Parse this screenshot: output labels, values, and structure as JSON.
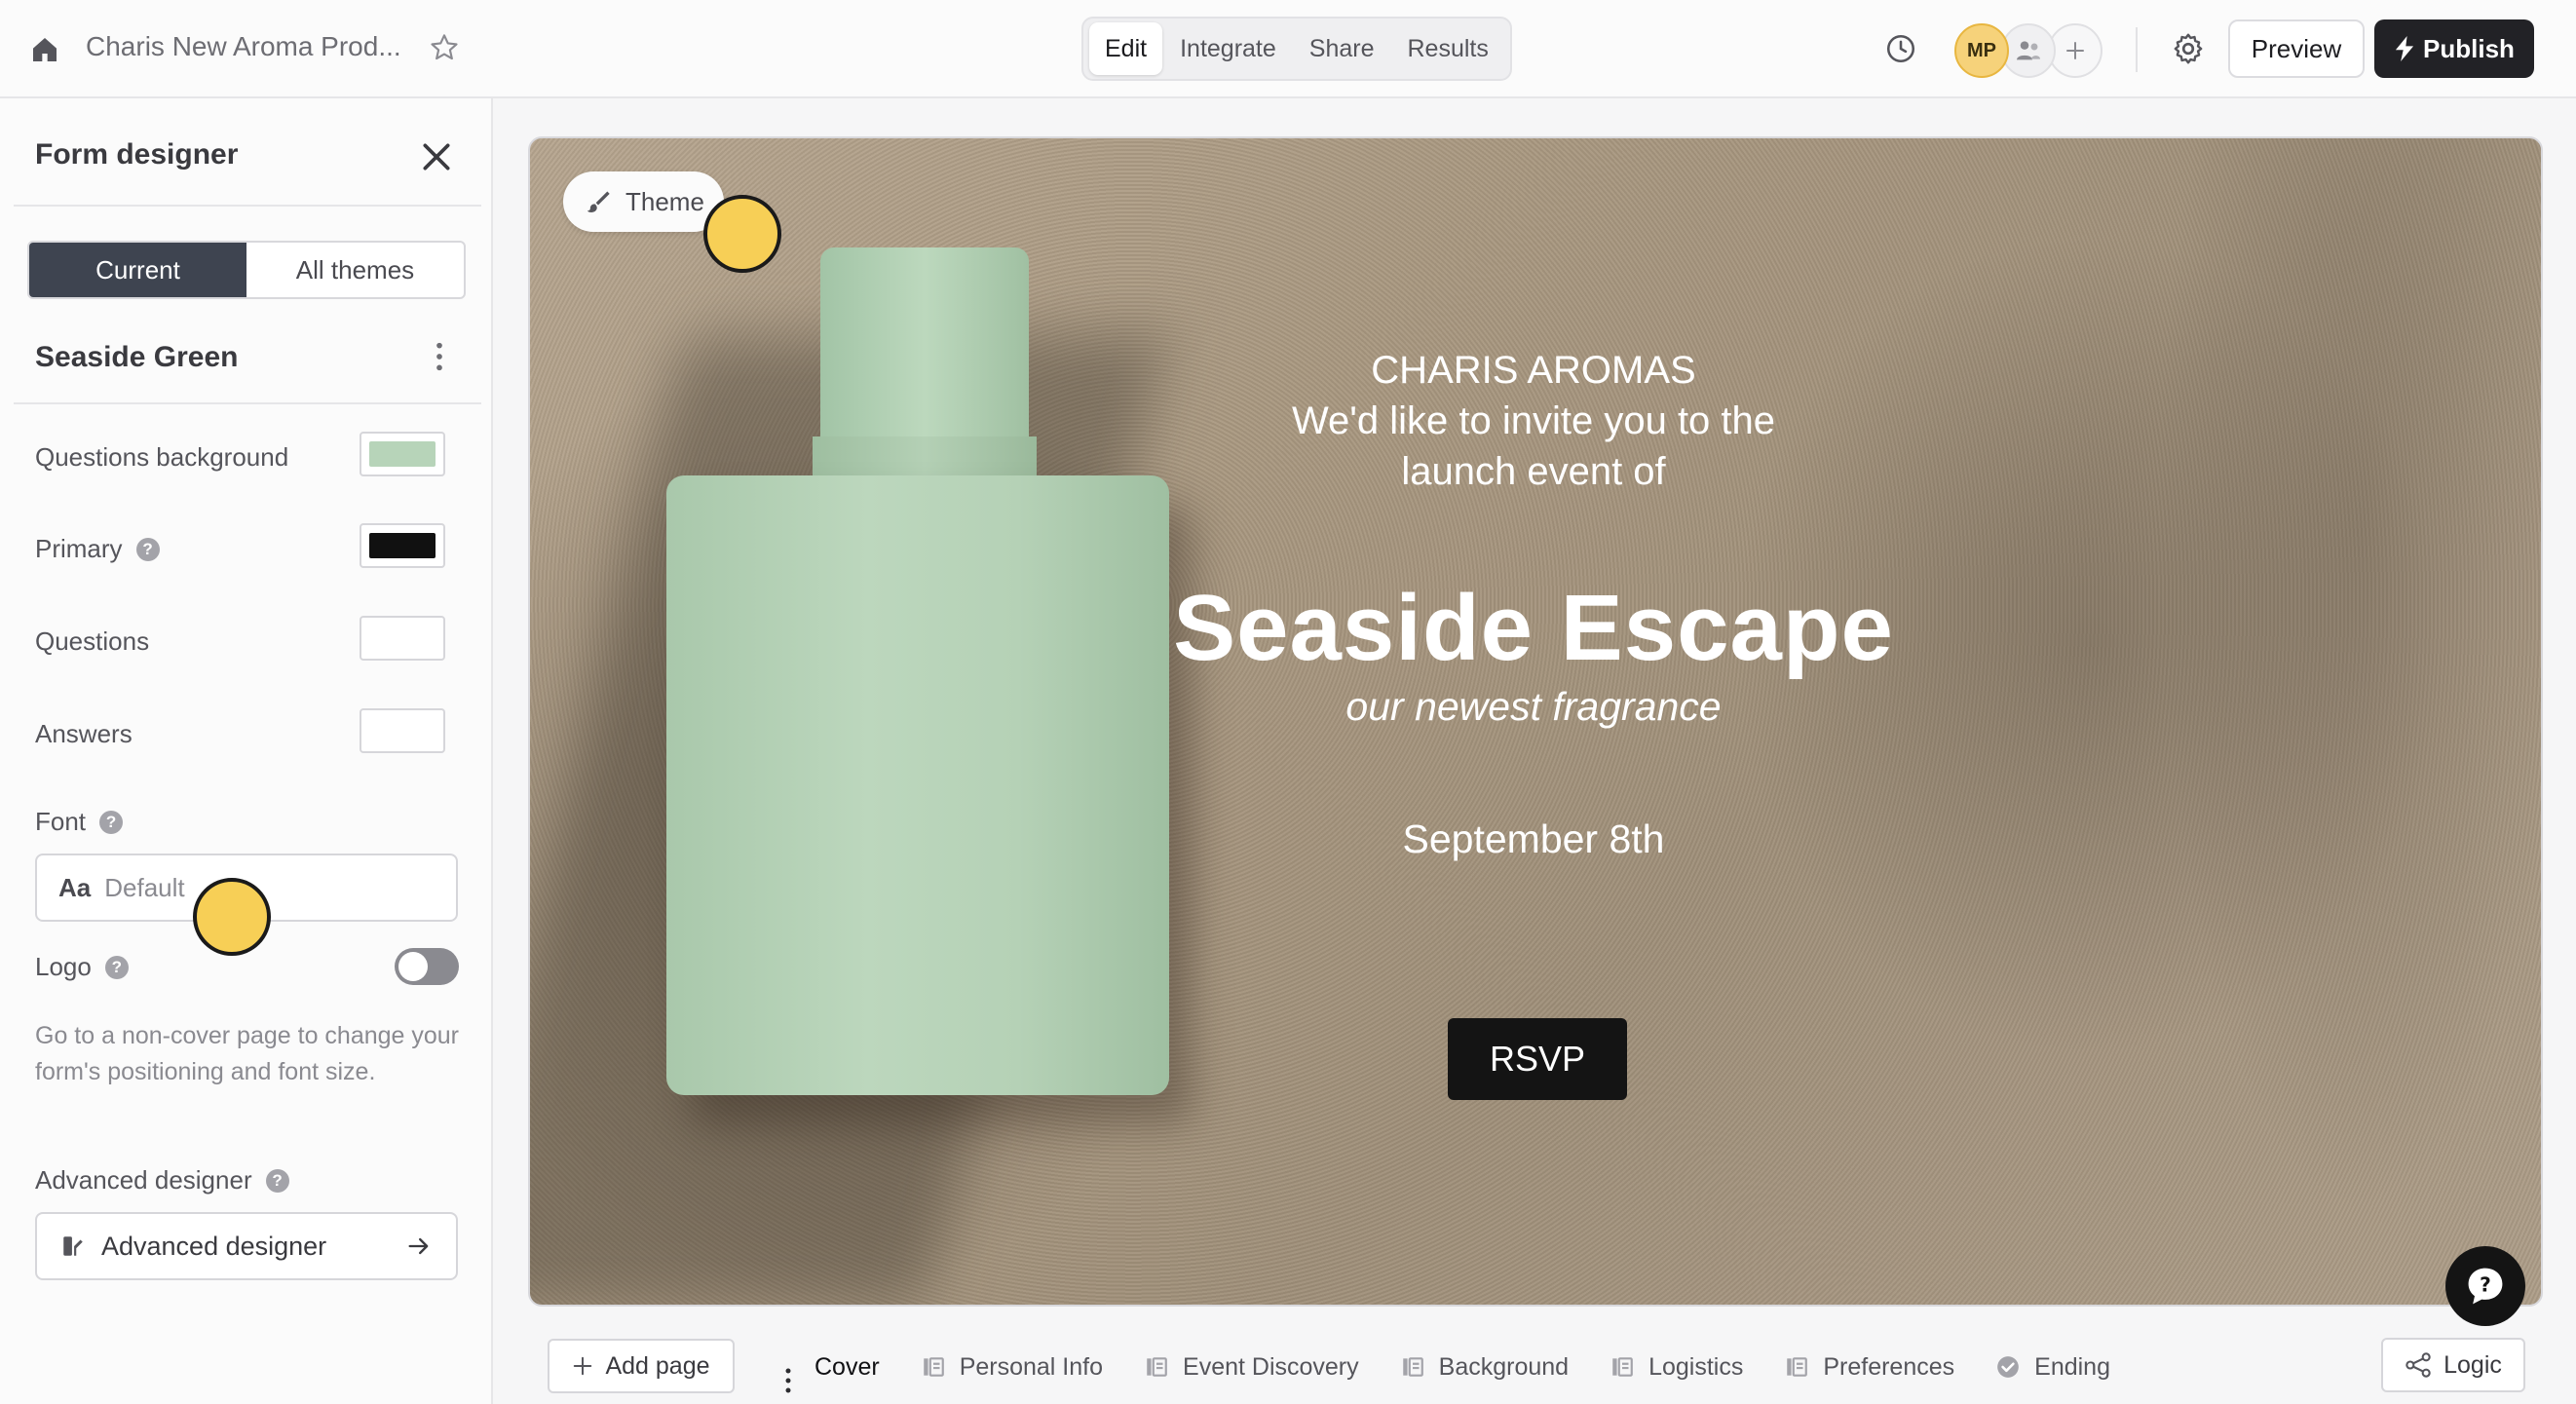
{
  "header": {
    "form_title": "Charis New Aroma Prod...",
    "modes": [
      {
        "label": "Edit",
        "active": true
      },
      {
        "label": "Integrate",
        "active": false
      },
      {
        "label": "Share",
        "active": false
      },
      {
        "label": "Results",
        "active": false
      }
    ],
    "avatar_initials": "MP",
    "preview_label": "Preview",
    "publish_label": "Publish"
  },
  "sidebar": {
    "title": "Form designer",
    "toggle": {
      "current": "Current",
      "all": "All themes"
    },
    "theme_name": "Seaside Green",
    "props": {
      "questions_background": {
        "label": "Questions background",
        "color": "#b7d4b9"
      },
      "primary": {
        "label": "Primary",
        "color": "#111111"
      },
      "questions": {
        "label": "Questions",
        "color": "#ffffff"
      },
      "answers": {
        "label": "Answers",
        "color": "#ffffff"
      }
    },
    "font": {
      "label": "Font",
      "aa": "Aa",
      "value": "Default"
    },
    "logo": {
      "label": "Logo",
      "enabled": false
    },
    "note": "Go to a non-cover page to change your form's positioning and font size.",
    "advanced": {
      "label": "Advanced designer",
      "button_label": "Advanced designer"
    }
  },
  "canvas": {
    "theme_pill": "Theme",
    "brand": "CHARIS AROMAS",
    "invite_line1": "We'd like to invite you to the",
    "invite_line2": "launch event of",
    "title": "Seaside Escape",
    "subtitle": "our newest fragrance",
    "date": "September 8th",
    "cta": "RSVP"
  },
  "bottom_bar": {
    "add_page": "Add page",
    "pages": [
      {
        "label": "Cover",
        "icon": "none",
        "active": true
      },
      {
        "label": "Personal Info",
        "icon": "page-icon",
        "active": false
      },
      {
        "label": "Event Discovery",
        "icon": "page-icon",
        "active": false
      },
      {
        "label": "Background",
        "icon": "page-icon",
        "active": false
      },
      {
        "label": "Logistics",
        "icon": "page-icon",
        "active": false
      },
      {
        "label": "Preferences",
        "icon": "page-icon",
        "active": false
      },
      {
        "label": "Ending",
        "icon": "check-circle-icon",
        "active": false
      }
    ],
    "logic": "Logic"
  }
}
